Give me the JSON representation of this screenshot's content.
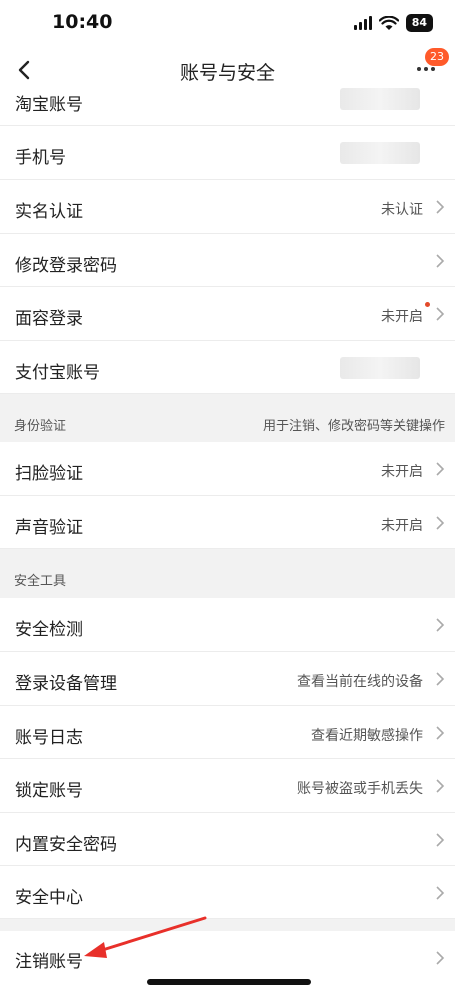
{
  "status_bar": {
    "time": "10:40",
    "battery": "84"
  },
  "nav": {
    "title": "账号与安全",
    "badge": "23"
  },
  "rows_group1": [
    {
      "label": "淘宝账号",
      "value": ""
    },
    {
      "label": "手机号",
      "value": ""
    },
    {
      "label": "实名认证",
      "value": "未认证"
    },
    {
      "label": "修改登录密码",
      "value": ""
    },
    {
      "label": "面容登录",
      "value": "未开启"
    },
    {
      "label": "支付宝账号",
      "value": ""
    }
  ],
  "section_identity": {
    "title": "身份验证",
    "note": "用于注销、修改密码等关键操作"
  },
  "rows_identity": [
    {
      "label": "扫脸验证",
      "value": "未开启"
    },
    {
      "label": "声音验证",
      "value": "未开启"
    }
  ],
  "section_tools": {
    "title": "安全工具"
  },
  "rows_tools": [
    {
      "label": "安全检测",
      "value": ""
    },
    {
      "label": "登录设备管理",
      "value": "查看当前在线的设备"
    },
    {
      "label": "账号日志",
      "value": "查看近期敏感操作"
    },
    {
      "label": "锁定账号",
      "value": "账号被盗或手机丢失"
    },
    {
      "label": "内置安全密码",
      "value": ""
    },
    {
      "label": "安全中心",
      "value": ""
    }
  ],
  "row_cancel": {
    "label": "注销账号"
  },
  "colors": {
    "accent_badge": "#ff5a2a",
    "arrow": "#e8302a",
    "section_bg": "#f2f2f2"
  }
}
